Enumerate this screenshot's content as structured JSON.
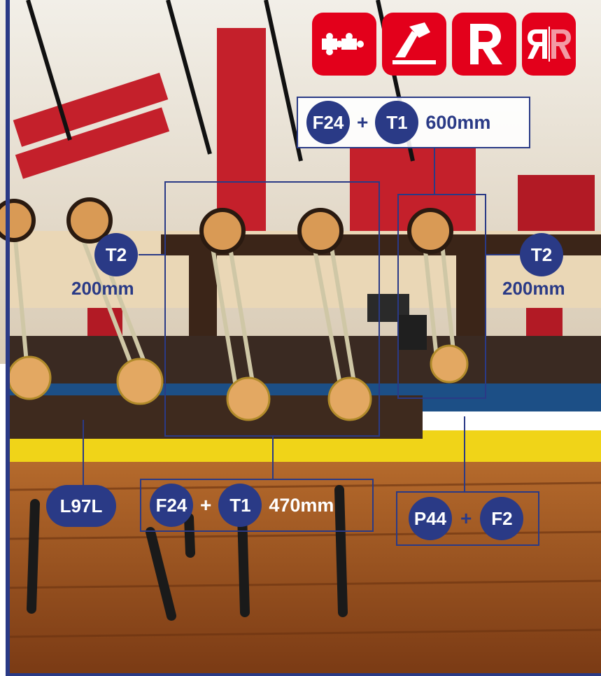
{
  "icons": [
    "puzzle-icon",
    "hammer-icon",
    "r-logo-icon",
    "rr-logo-icon"
  ],
  "colors": {
    "accent": "#2a3a86",
    "badge": "#e3001b"
  },
  "labels": {
    "top": {
      "a": "F24",
      "plus": "+",
      "b": "T1",
      "length": "600mm"
    },
    "bottom": {
      "a": "F24",
      "plus": "+",
      "b": "T1",
      "length": "470mm"
    },
    "left_t2": {
      "code": "T2",
      "length": "200mm"
    },
    "right_t2": {
      "code": "T2",
      "length": "200mm"
    },
    "part_l97l": "L97L",
    "hook": {
      "a": "P44",
      "plus": "+",
      "b": "F2"
    }
  }
}
